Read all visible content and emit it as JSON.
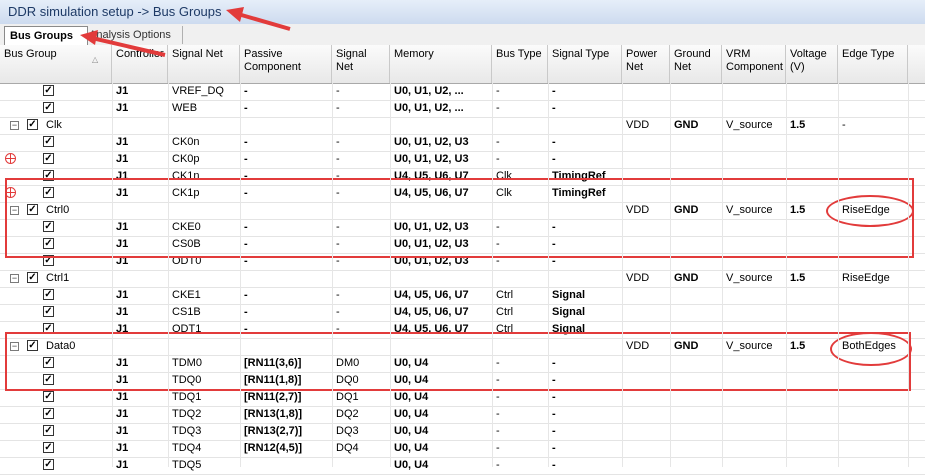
{
  "window": {
    "title": "DDR simulation setup -> Bus Groups"
  },
  "tabs": [
    {
      "label": "Bus Groups",
      "active": true
    },
    {
      "label": "Analysis Options",
      "active": false
    }
  ],
  "columns": [
    "Bus Group",
    "Controller",
    "Signal Net",
    "Passive Component",
    "Signal Net",
    "Memory",
    "Bus Type",
    "Signal Type",
    "Power Net",
    "Ground Net",
    "VRM Component",
    "Voltage (V)",
    "Edge Type"
  ],
  "rows": [
    {
      "level": "child",
      "group": "",
      "controller": "J1",
      "signal_net": "VREF_DQ",
      "passive": "-",
      "signal_net2": "-",
      "memory": "U0, U1, U2, ...",
      "bus_type": "-",
      "signal_type": "-",
      "power": "",
      "ground": "",
      "vrm": "",
      "voltage": "",
      "edge": ""
    },
    {
      "level": "child",
      "group": "",
      "controller": "J1",
      "signal_net": "WEB",
      "passive": "-",
      "signal_net2": "-",
      "memory": "U0, U1, U2, ...",
      "bus_type": "-",
      "signal_type": "-",
      "power": "",
      "ground": "",
      "vrm": "",
      "voltage": "",
      "edge": ""
    },
    {
      "level": "group",
      "group": "Clk",
      "controller": "",
      "signal_net": "",
      "passive": "",
      "signal_net2": "",
      "memory": "",
      "bus_type": "",
      "signal_type": "",
      "power": "VDD",
      "ground": "GND",
      "vrm": "V_source",
      "voltage": "1.5",
      "edge": "-"
    },
    {
      "level": "child",
      "group": "",
      "controller": "J1",
      "signal_net": "CK0n",
      "passive": "-",
      "signal_net2": "-",
      "memory": "U0, U1, U2, U3",
      "bus_type": "-",
      "signal_type": "-",
      "power": "",
      "ground": "",
      "vrm": "",
      "voltage": "",
      "edge": ""
    },
    {
      "level": "child",
      "group": "",
      "controller": "J1",
      "signal_net": "CK0p",
      "passive": "-",
      "signal_net2": "-",
      "memory": "U0, U1, U2, U3",
      "bus_type": "-",
      "signal_type": "-",
      "power": "",
      "ground": "",
      "vrm": "",
      "voltage": "",
      "edge": ""
    },
    {
      "level": "child",
      "group": "",
      "controller": "J1",
      "signal_net": "CK1n",
      "passive": "-",
      "signal_net2": "-",
      "memory": "U4, U5, U6, U7",
      "bus_type": "Clk",
      "signal_type": "TimingRef",
      "power": "",
      "ground": "",
      "vrm": "",
      "voltage": "",
      "edge": ""
    },
    {
      "level": "child",
      "group": "",
      "controller": "J1",
      "signal_net": "CK1p",
      "passive": "-",
      "signal_net2": "-",
      "memory": "U4, U5, U6, U7",
      "bus_type": "Clk",
      "signal_type": "TimingRef",
      "power": "",
      "ground": "",
      "vrm": "",
      "voltage": "",
      "edge": ""
    },
    {
      "level": "group",
      "group": "Ctrl0",
      "controller": "",
      "signal_net": "",
      "passive": "",
      "signal_net2": "",
      "memory": "",
      "bus_type": "",
      "signal_type": "",
      "power": "VDD",
      "ground": "GND",
      "vrm": "V_source",
      "voltage": "1.5",
      "edge": "RiseEdge"
    },
    {
      "level": "child",
      "group": "",
      "controller": "J1",
      "signal_net": "CKE0",
      "passive": "-",
      "signal_net2": "-",
      "memory": "U0, U1, U2, U3",
      "bus_type": "-",
      "signal_type": "-",
      "power": "",
      "ground": "",
      "vrm": "",
      "voltage": "",
      "edge": ""
    },
    {
      "level": "child",
      "group": "",
      "controller": "J1",
      "signal_net": "CS0B",
      "passive": "-",
      "signal_net2": "-",
      "memory": "U0, U1, U2, U3",
      "bus_type": "-",
      "signal_type": "-",
      "power": "",
      "ground": "",
      "vrm": "",
      "voltage": "",
      "edge": ""
    },
    {
      "level": "child",
      "group": "",
      "controller": "J1",
      "signal_net": "ODT0",
      "passive": "-",
      "signal_net2": "-",
      "memory": "U0, U1, U2, U3",
      "bus_type": "-",
      "signal_type": "-",
      "power": "",
      "ground": "",
      "vrm": "",
      "voltage": "",
      "edge": ""
    },
    {
      "level": "group",
      "group": "Ctrl1",
      "controller": "",
      "signal_net": "",
      "passive": "",
      "signal_net2": "",
      "memory": "",
      "bus_type": "",
      "signal_type": "",
      "power": "VDD",
      "ground": "GND",
      "vrm": "V_source",
      "voltage": "1.5",
      "edge": "RiseEdge"
    },
    {
      "level": "child",
      "group": "",
      "controller": "J1",
      "signal_net": "CKE1",
      "passive": "-",
      "signal_net2": "-",
      "memory": "U4, U5, U6, U7",
      "bus_type": "Ctrl",
      "signal_type": "Signal",
      "power": "",
      "ground": "",
      "vrm": "",
      "voltage": "",
      "edge": ""
    },
    {
      "level": "child",
      "group": "",
      "controller": "J1",
      "signal_net": "CS1B",
      "passive": "-",
      "signal_net2": "-",
      "memory": "U4, U5, U6, U7",
      "bus_type": "Ctrl",
      "signal_type": "Signal",
      "power": "",
      "ground": "",
      "vrm": "",
      "voltage": "",
      "edge": ""
    },
    {
      "level": "child",
      "group": "",
      "controller": "J1",
      "signal_net": "ODT1",
      "passive": "-",
      "signal_net2": "-",
      "memory": "U4, U5, U6, U7",
      "bus_type": "Ctrl",
      "signal_type": "Signal",
      "power": "",
      "ground": "",
      "vrm": "",
      "voltage": "",
      "edge": ""
    },
    {
      "level": "group",
      "group": "Data0",
      "controller": "",
      "signal_net": "",
      "passive": "",
      "signal_net2": "",
      "memory": "",
      "bus_type": "",
      "signal_type": "",
      "power": "VDD",
      "ground": "GND",
      "vrm": "V_source",
      "voltage": "1.5",
      "edge": "BothEdges"
    },
    {
      "level": "child",
      "group": "",
      "controller": "J1",
      "signal_net": "TDM0",
      "passive": "[RN11(3,6)]",
      "signal_net2": "DM0",
      "memory": "U0, U4",
      "bus_type": "-",
      "signal_type": "-",
      "power": "",
      "ground": "",
      "vrm": "",
      "voltage": "",
      "edge": ""
    },
    {
      "level": "child",
      "group": "",
      "controller": "J1",
      "signal_net": "TDQ0",
      "passive": "[RN11(1,8)]",
      "signal_net2": "DQ0",
      "memory": "U0, U4",
      "bus_type": "-",
      "signal_type": "-",
      "power": "",
      "ground": "",
      "vrm": "",
      "voltage": "",
      "edge": ""
    },
    {
      "level": "child",
      "group": "",
      "controller": "J1",
      "signal_net": "TDQ1",
      "passive": "[RN11(2,7)]",
      "signal_net2": "DQ1",
      "memory": "U0, U4",
      "bus_type": "-",
      "signal_type": "-",
      "power": "",
      "ground": "",
      "vrm": "",
      "voltage": "",
      "edge": ""
    },
    {
      "level": "child",
      "group": "",
      "controller": "J1",
      "signal_net": "TDQ2",
      "passive": "[RN13(1,8)]",
      "signal_net2": "DQ2",
      "memory": "U0, U4",
      "bus_type": "-",
      "signal_type": "-",
      "power": "",
      "ground": "",
      "vrm": "",
      "voltage": "",
      "edge": ""
    },
    {
      "level": "child",
      "group": "",
      "controller": "J1",
      "signal_net": "TDQ3",
      "passive": "[RN13(2,7)]",
      "signal_net2": "DQ3",
      "memory": "U0, U4",
      "bus_type": "-",
      "signal_type": "-",
      "power": "",
      "ground": "",
      "vrm": "",
      "voltage": "",
      "edge": ""
    },
    {
      "level": "child",
      "group": "",
      "controller": "J1",
      "signal_net": "TDQ4",
      "passive": "[RN12(4,5)]",
      "signal_net2": "DQ4",
      "memory": "U0, U4",
      "bus_type": "-",
      "signal_type": "-",
      "power": "",
      "ground": "",
      "vrm": "",
      "voltage": "",
      "edge": ""
    },
    {
      "level": "child",
      "group": "",
      "controller": "J1",
      "signal_net": "TDQ5",
      "passive": "",
      "signal_net2": "",
      "memory": "U0, U4",
      "bus_type": "-",
      "signal_type": "-",
      "power": "",
      "ground": "",
      "vrm": "",
      "voltage": "",
      "edge": ""
    }
  ],
  "annotations": {
    "color": "#e23b3b"
  },
  "colors": {
    "title_text": "#1e3a66",
    "header_bg": "#eeeeee",
    "annotation": "#e23b3b"
  }
}
